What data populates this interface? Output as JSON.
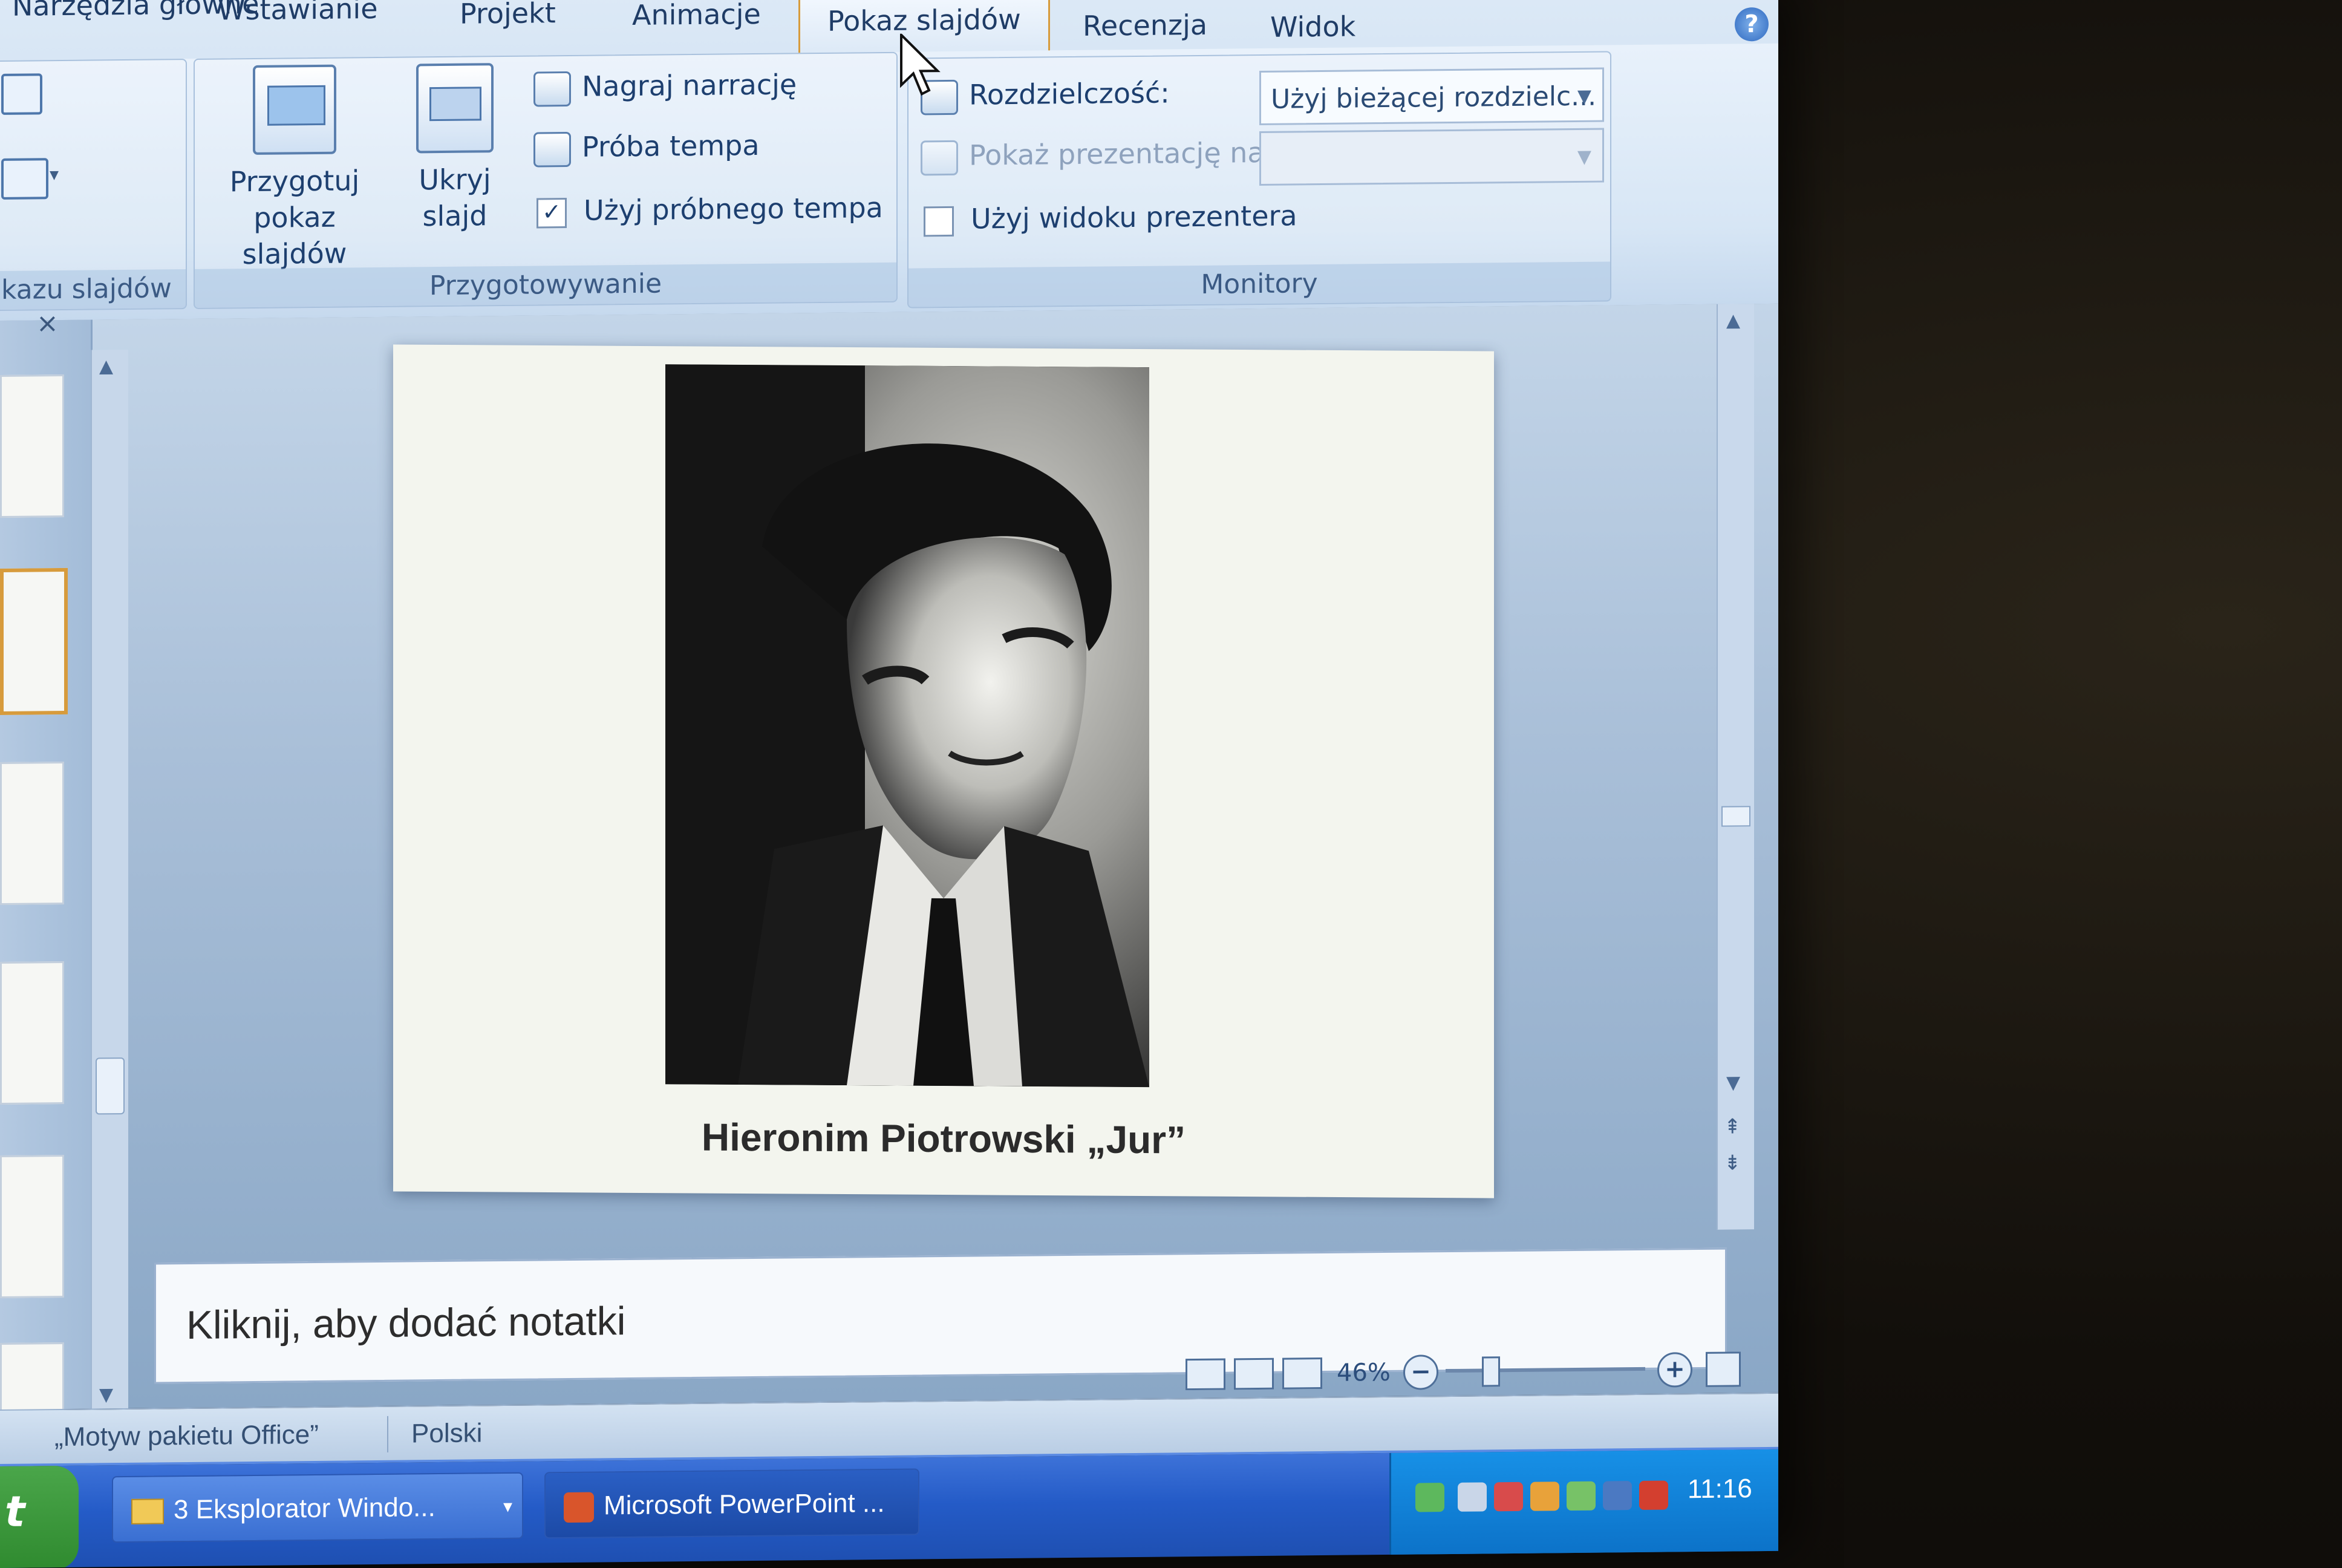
{
  "ribbon": {
    "tabs": [
      "Narzędzia główne",
      "Wstawianie",
      "Projekt",
      "Animacje",
      "Pokaz slajdów",
      "Recenzja",
      "Widok"
    ],
    "active_tab": "Pokaz slajdów",
    "group_left_label": "kazu slajdów",
    "setup": {
      "label": "Przygotowywanie",
      "przygotuj_line1": "Przygotuj",
      "przygotuj_line2": "pokaz slajdów",
      "ukryj_line1": "Ukryj",
      "ukryj_line2": "slajd",
      "nagraj": "Nagraj narrację",
      "proba": "Próba tempa",
      "uzyj_probnego": "Użyj próbnego tempa",
      "uzyj_probnego_checked": true
    },
    "monitors": {
      "label": "Monitory",
      "resolution_label": "Rozdzielczość:",
      "resolution_value": "Użyj bieżącej rozdzielc...",
      "show_on_label": "Pokaż prezentację na:",
      "show_on_value": "",
      "presenter_view": "Użyj widoku prezentera",
      "presenter_view_checked": false
    }
  },
  "slide": {
    "caption": "Hieronim Piotrowski „Jur”"
  },
  "notes": {
    "placeholder": "Kliknij, aby dodać notatki"
  },
  "viewbar": {
    "zoom": "46%"
  },
  "statusbar": {
    "theme": "„Motyw pakietu Office”",
    "language": "Polski"
  },
  "taskbar": {
    "start": "t",
    "items": [
      "3 Eksplorator Windo...",
      "Microsoft PowerPoint ..."
    ],
    "clock": "11:16"
  },
  "colors": {
    "ribbon_bg": "#d7e6f5",
    "active_tab_border": "#d79b3c",
    "taskbar": "#245bc7",
    "tray": "#0c72c8"
  }
}
